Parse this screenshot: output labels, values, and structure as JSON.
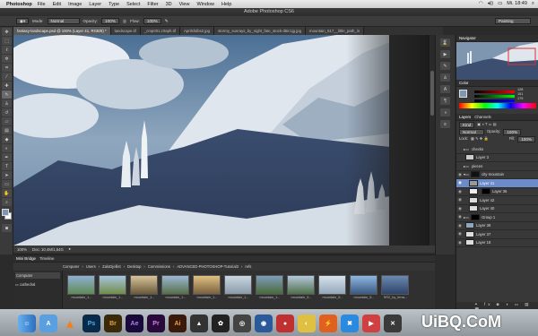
{
  "menubar": {
    "app": "Photoshop",
    "items": [
      "File",
      "Edit",
      "Image",
      "Layer",
      "Type",
      "Select",
      "Filter",
      "3D",
      "View",
      "Window",
      "Help"
    ],
    "time": "Mi. 18:49"
  },
  "window": {
    "title": "Adobe Photoshop CS6"
  },
  "options": {
    "mode_label": "Mode:",
    "mode_value": "Normal",
    "opacity_label": "Opacity:",
    "opacity_value": "100%",
    "flow_label": "Flow:",
    "flow_value": "100%",
    "workspace": "Painting"
  },
  "tabs": [
    "fantasy-landscape.psd @ 100% (Layer 41, RGB/8) *",
    "landscape.tif",
    "_cmp001.z0aph.tif",
    "Aprilsfolbs2.jpg",
    "stormy_sunrays_by_night_fate_stock-d6ic1jg.jpg",
    "mountain_517__little_path_in"
  ],
  "status": {
    "zoom": "100%",
    "doc": "Doc: 10,4M/1,54G"
  },
  "panels": {
    "navigator": "Navigator",
    "color": "Color",
    "color_values": [
      "128",
      "151",
      "179"
    ],
    "layers_tab": "Layers",
    "channels_tab": "Channels",
    "kind": "Kind",
    "blend": "Normal",
    "opacity_label": "Opacity:",
    "opacity_value": "100%",
    "lock_label": "Lock:",
    "fill_label": "Fill:",
    "fill_value": "100%"
  },
  "layers": [
    "checks",
    "Layer 3",
    "pieces",
    "city-mountain",
    "Layer 41",
    "Layer 36",
    "Layer 42",
    "Layer 40",
    "Group 1",
    "Layer 38",
    "Layer 37",
    "Layer 18"
  ],
  "bridge": {
    "tab1": "Mini Bridge",
    "tab2": "Timeline",
    "path": [
      "Computer",
      "Users",
      "ZaloDjellist",
      "Desktop",
      "Commissions",
      "ADVANCED-PHOTOSHOP-Tutorial3",
      "refs"
    ],
    "sidebar_label": "Computer",
    "folder": "cathedral",
    "thumbs": [
      "mountain_1...",
      "mountain_1...",
      "mountain_1...",
      "mountain_1...",
      "mountain_1...",
      "mountain_1...",
      "mountain_1...",
      "mountain_5...",
      "mountain_5...",
      "mountain_5...",
      "SR2_by_ferra..."
    ]
  },
  "dock": [
    "Ps",
    "Br",
    "Ae",
    "Pr",
    "Ai"
  ],
  "watermark": "UiBQ.CoM",
  "colors": {
    "accent": "#6c8bc9",
    "fg_swatch": "#7f97b3"
  }
}
